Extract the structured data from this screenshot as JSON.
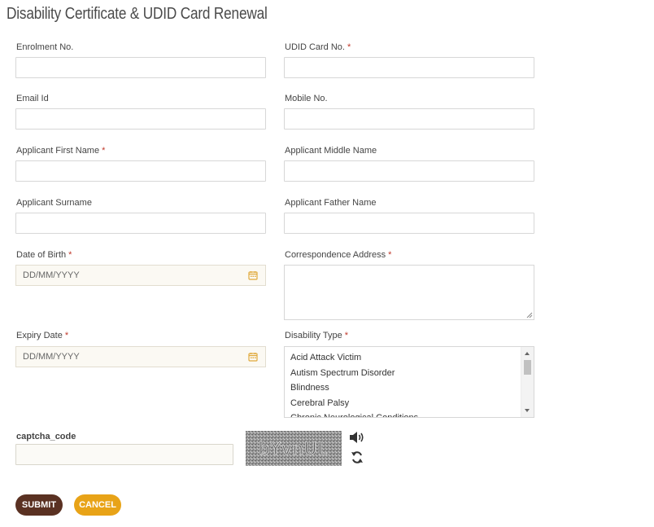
{
  "page": {
    "title": "Disability Certificate & UDID Card Renewal"
  },
  "form": {
    "enrolment_label": "Enrolment No.",
    "udid_label": "UDID Card No.",
    "email_label": "Email Id",
    "mobile_label": "Mobile No.",
    "first_name_label": "Applicant First Name",
    "middle_name_label": "Applicant Middle Name",
    "surname_label": "Applicant Surname",
    "father_name_label": "Applicant Father Name",
    "dob_label": "Date of Birth",
    "dob_placeholder": "DD/MM/YYYY",
    "address_label": "Correspondence Address",
    "expiry_label": "Expiry Date",
    "expiry_placeholder": "DD/MM/YYYY",
    "disability_label": "Disability Type",
    "disability_options": [
      "Acid Attack Victim",
      "Autism Spectrum Disorder",
      "Blindness",
      "Cerebral Palsy",
      "Chronic Neurological Conditions"
    ],
    "required_mark": "*"
  },
  "captcha": {
    "label": "captcha_code",
    "image_text": "bYvnUL",
    "audio_icon": "speaker-icon",
    "refresh_icon": "refresh-icon"
  },
  "actions": {
    "submit_label": "SUBMIT",
    "cancel_label": "CANCEL"
  },
  "colors": {
    "submit_bg": "#5a3122",
    "cancel_bg": "#e8a317",
    "required": "#c0392b",
    "calendar": "#e0a93a"
  }
}
